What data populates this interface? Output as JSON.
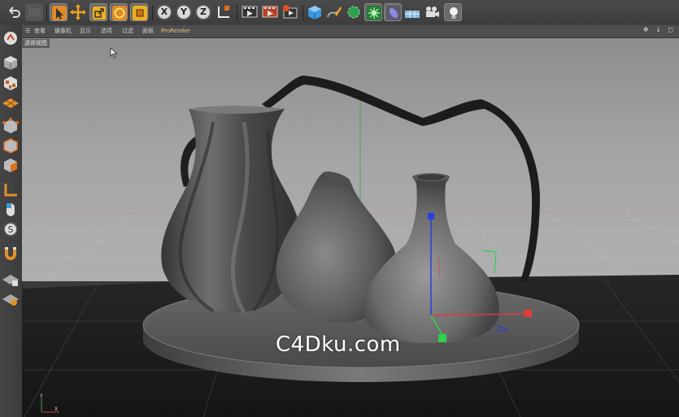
{
  "toolbar": {
    "axis_x": "X",
    "axis_y": "Y",
    "axis_z": "Z",
    "tools": [
      "undo-icon",
      "redo-icon",
      "select-arrow-icon",
      "move-icon",
      "scale-icon",
      "rotate-icon",
      "recent-tool-icon",
      "x-axis-lock",
      "y-axis-lock",
      "z-axis-lock",
      "coordinate-system-icon",
      "render-view-icon",
      "render-picture-viewer-icon",
      "edit-render-settings-icon",
      "cube-primitive-icon",
      "spline-pen-icon",
      "subdivision-nurbs-icon",
      "array-generator-icon",
      "deformer-icon",
      "floor-environment-icon",
      "camera-icon",
      "light-icon"
    ]
  },
  "viewport": {
    "menu": [
      "查看",
      "摄像机",
      "显示",
      "选项",
      "过滤",
      "面板",
      "ProRender"
    ],
    "label": "透视视图",
    "nav_controls": "✥ ↓ ◻"
  },
  "watermark": "C4Dku.com",
  "colors": {
    "axis_red": "#e23b3b",
    "axis_green": "#2fd04b",
    "axis_blue": "#2b3de0",
    "pro_render": "#e6c27a",
    "scene_bg": "#a0a0a0",
    "floor": "#1a1a1a"
  }
}
